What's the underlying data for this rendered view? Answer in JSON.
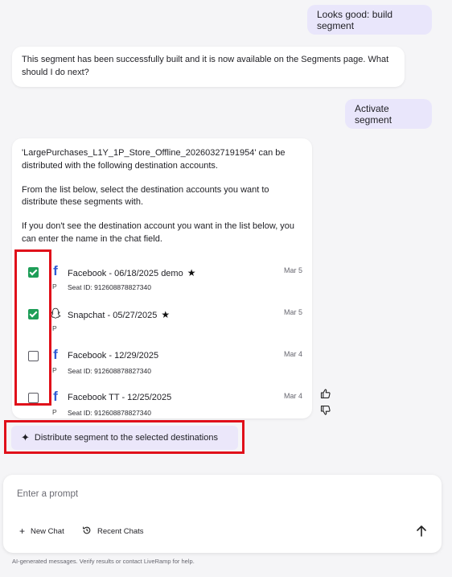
{
  "messages": {
    "user_1": "Looks good: build segment",
    "bot_1": "This segment has been successfully built and it is now available on the Segments page. What should I do next?",
    "user_2": "Activate segment",
    "bot_2": {
      "para_1": "'LargePurchases_L1Y_1P_Store_Offline_20260327191954' can be distributed with the following destination accounts.",
      "para_2": "From the list below, select the destination accounts you want to distribute these segments with.",
      "para_3": "If you don't see the destination account you want in the list below, you can enter the name in the chat field."
    }
  },
  "destinations": [
    {
      "name": "Facebook - 06/18/2025 demo",
      "date": "Mar 5",
      "type": "P",
      "seat": "Seat ID: 912608878827340",
      "checked": true,
      "favorite": true,
      "icon": "facebook-icon"
    },
    {
      "name": "Snapchat - 05/27/2025",
      "date": "Mar 5",
      "type": "P",
      "seat": "",
      "checked": true,
      "favorite": true,
      "icon": "snapchat-icon"
    },
    {
      "name": "Facebook - 12/29/2025",
      "date": "Mar 4",
      "type": "P",
      "seat": "Seat ID: 912608878827340",
      "checked": false,
      "favorite": false,
      "icon": "facebook-icon"
    },
    {
      "name": "Facebook TT - 12/25/2025",
      "date": "Mar 4",
      "type": "P",
      "seat": "Seat ID: 912608878827340",
      "checked": false,
      "favorite": false,
      "icon": "facebook-icon"
    }
  ],
  "actions": {
    "distribute_label": "Distribute segment to the selected destinations"
  },
  "composer": {
    "placeholder": "Enter a prompt",
    "new_chat": "New Chat",
    "recent_chats": "Recent Chats"
  },
  "footer": "AI-generated messages. Verify results or contact LiveRamp for help.",
  "colors": {
    "user_bubble": "#e9e6fb",
    "checkbox_checked": "#1e9e58",
    "facebook": "#2f5bd6",
    "highlight_box": "#e0101a",
    "distribute_button": "#ebe7fa"
  }
}
